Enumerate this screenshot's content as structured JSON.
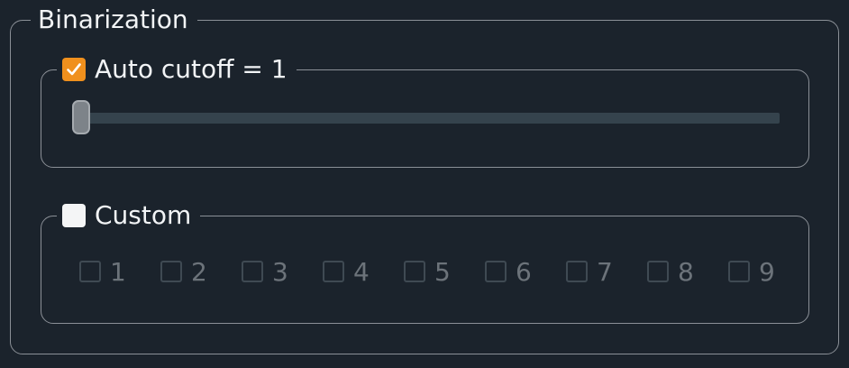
{
  "binarization": {
    "title": "Binarization",
    "auto": {
      "label": "Auto cutoff = 1",
      "checked": true,
      "slider_value": 1
    },
    "custom": {
      "label": "Custom",
      "checked": false,
      "options": [
        "1",
        "2",
        "3",
        "4",
        "5",
        "6",
        "7",
        "8",
        "9"
      ]
    }
  },
  "colors": {
    "accent": "#f0901d",
    "background": "#1b232c",
    "border": "#8b9097",
    "disabled_text": "#6c737a"
  }
}
